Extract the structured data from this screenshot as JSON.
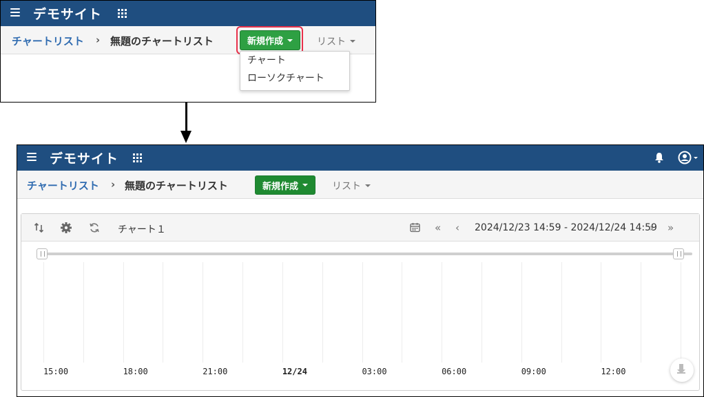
{
  "header": {
    "site_title": "デモサイト"
  },
  "breadcrumb": {
    "root": "チャートリスト",
    "separator": "›",
    "current": "無題のチャートリスト"
  },
  "toolbar": {
    "new_button": "新規作成",
    "list_button": "リスト"
  },
  "dropdown": {
    "items": [
      "チャート",
      "ローソクチャート"
    ]
  },
  "chart_panel": {
    "title": "チャート１",
    "range": "2024/12/23 14:59 - 2024/12/24 14:59",
    "first_label": "«",
    "prev_label": "‹",
    "next_label": "›",
    "last_label": "»"
  },
  "chart_data": {
    "type": "line",
    "series": [],
    "x_ticks": [
      "15:00",
      "18:00",
      "21:00",
      "12/24",
      "03:00",
      "06:00",
      "09:00",
      "12:00"
    ],
    "grid": true
  },
  "colors": {
    "header_bg": "#1f4e80",
    "new_button_bg": "#2ea043",
    "link": "#2f6bb0",
    "highlight": "#e8304a"
  }
}
